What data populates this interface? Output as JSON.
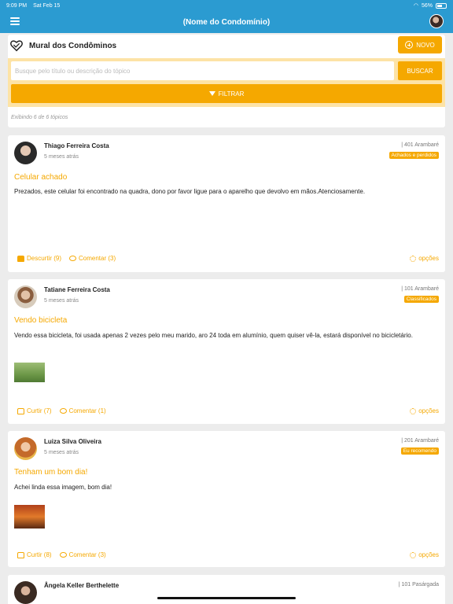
{
  "status": {
    "time": "9:09 PM",
    "date": "Sat Feb 15",
    "battery": "56%"
  },
  "nav": {
    "title": "(Nome do Condomínio)",
    "menu_icon": "hamburger-menu-icon",
    "avatar_icon": "user-avatar"
  },
  "header": {
    "title": "Mural dos Condôminos",
    "novo_label": "NOVO",
    "search_placeholder": "Busque pelo título ou descrição do tópico",
    "buscar_label": "BUSCAR",
    "filtrar_label": "FILTRAR",
    "counter": "Exibindo 6 de 6 tópicos"
  },
  "posts": [
    {
      "author": "Thiago Ferreira Costa",
      "time": "5 meses atrás",
      "unit": "| 401 Arambaré",
      "tag": "Achados e perdidos",
      "title": "Celular achado",
      "body": "Prezados, este celular foi encontrado na quadra, dono por favor ligue para o aparelho que devolvo em mãos.Atenciosamente.",
      "like_label": "Descurtir (9)",
      "comment_label": "Comentar (3)",
      "options_label": "opções"
    },
    {
      "author": "Tatiane Ferreira Costa",
      "time": "5 meses atrás",
      "unit": "| 101 Arambaré",
      "tag": "Classificados",
      "title": "Vendo bicicleta",
      "body": "Vendo essa bicicleta, foi usada apenas 2 vezes pelo meu marido, aro 24 toda em alumínio, quem quiser vê-la, estará disponível no bicicletário.",
      "like_label": "Curtir (7)",
      "comment_label": "Comentar (1)",
      "options_label": "opções"
    },
    {
      "author": "Luiza Silva Oliveira",
      "time": "5 meses atrás",
      "unit": "| 201 Arambaré",
      "tag": "Eu recomendo",
      "title": "Tenham um bom dia!",
      "body": "Achei linda essa imagem, bom dia!",
      "like_label": "Curtir (8)",
      "comment_label": "Comentar (3)",
      "options_label": "opções"
    },
    {
      "author": "Ângela Keller Berthelette",
      "unit": "| 101 Pasárgada"
    }
  ]
}
